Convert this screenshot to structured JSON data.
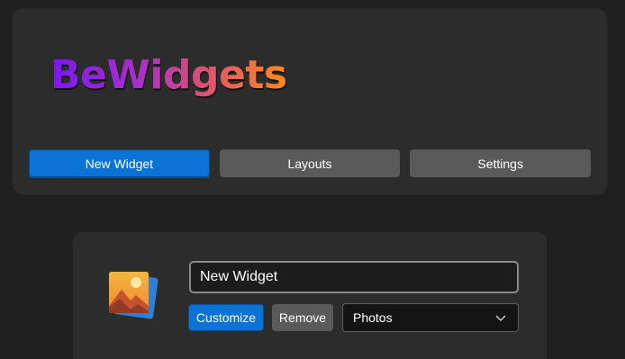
{
  "app": {
    "title": "BeWidgets"
  },
  "nav": {
    "items": [
      {
        "label": "New Widget",
        "active": true
      },
      {
        "label": "Layouts",
        "active": false
      },
      {
        "label": "Settings",
        "active": false
      }
    ]
  },
  "widget": {
    "icon": "photo-gallery-icon",
    "name_value": "New Widget",
    "customize_label": "Customize",
    "remove_label": "Remove",
    "type_select": {
      "selected": "Photos",
      "icon": "chevron-down-icon"
    }
  },
  "colors": {
    "accent": "#0b72d6",
    "background": "#202020",
    "card": "#2c2c2c",
    "secondary_button": "#5a5a5a",
    "brand_gradient": [
      "#7b18f0",
      "#a930c8",
      "#e0566a",
      "#ff8a1e"
    ]
  }
}
